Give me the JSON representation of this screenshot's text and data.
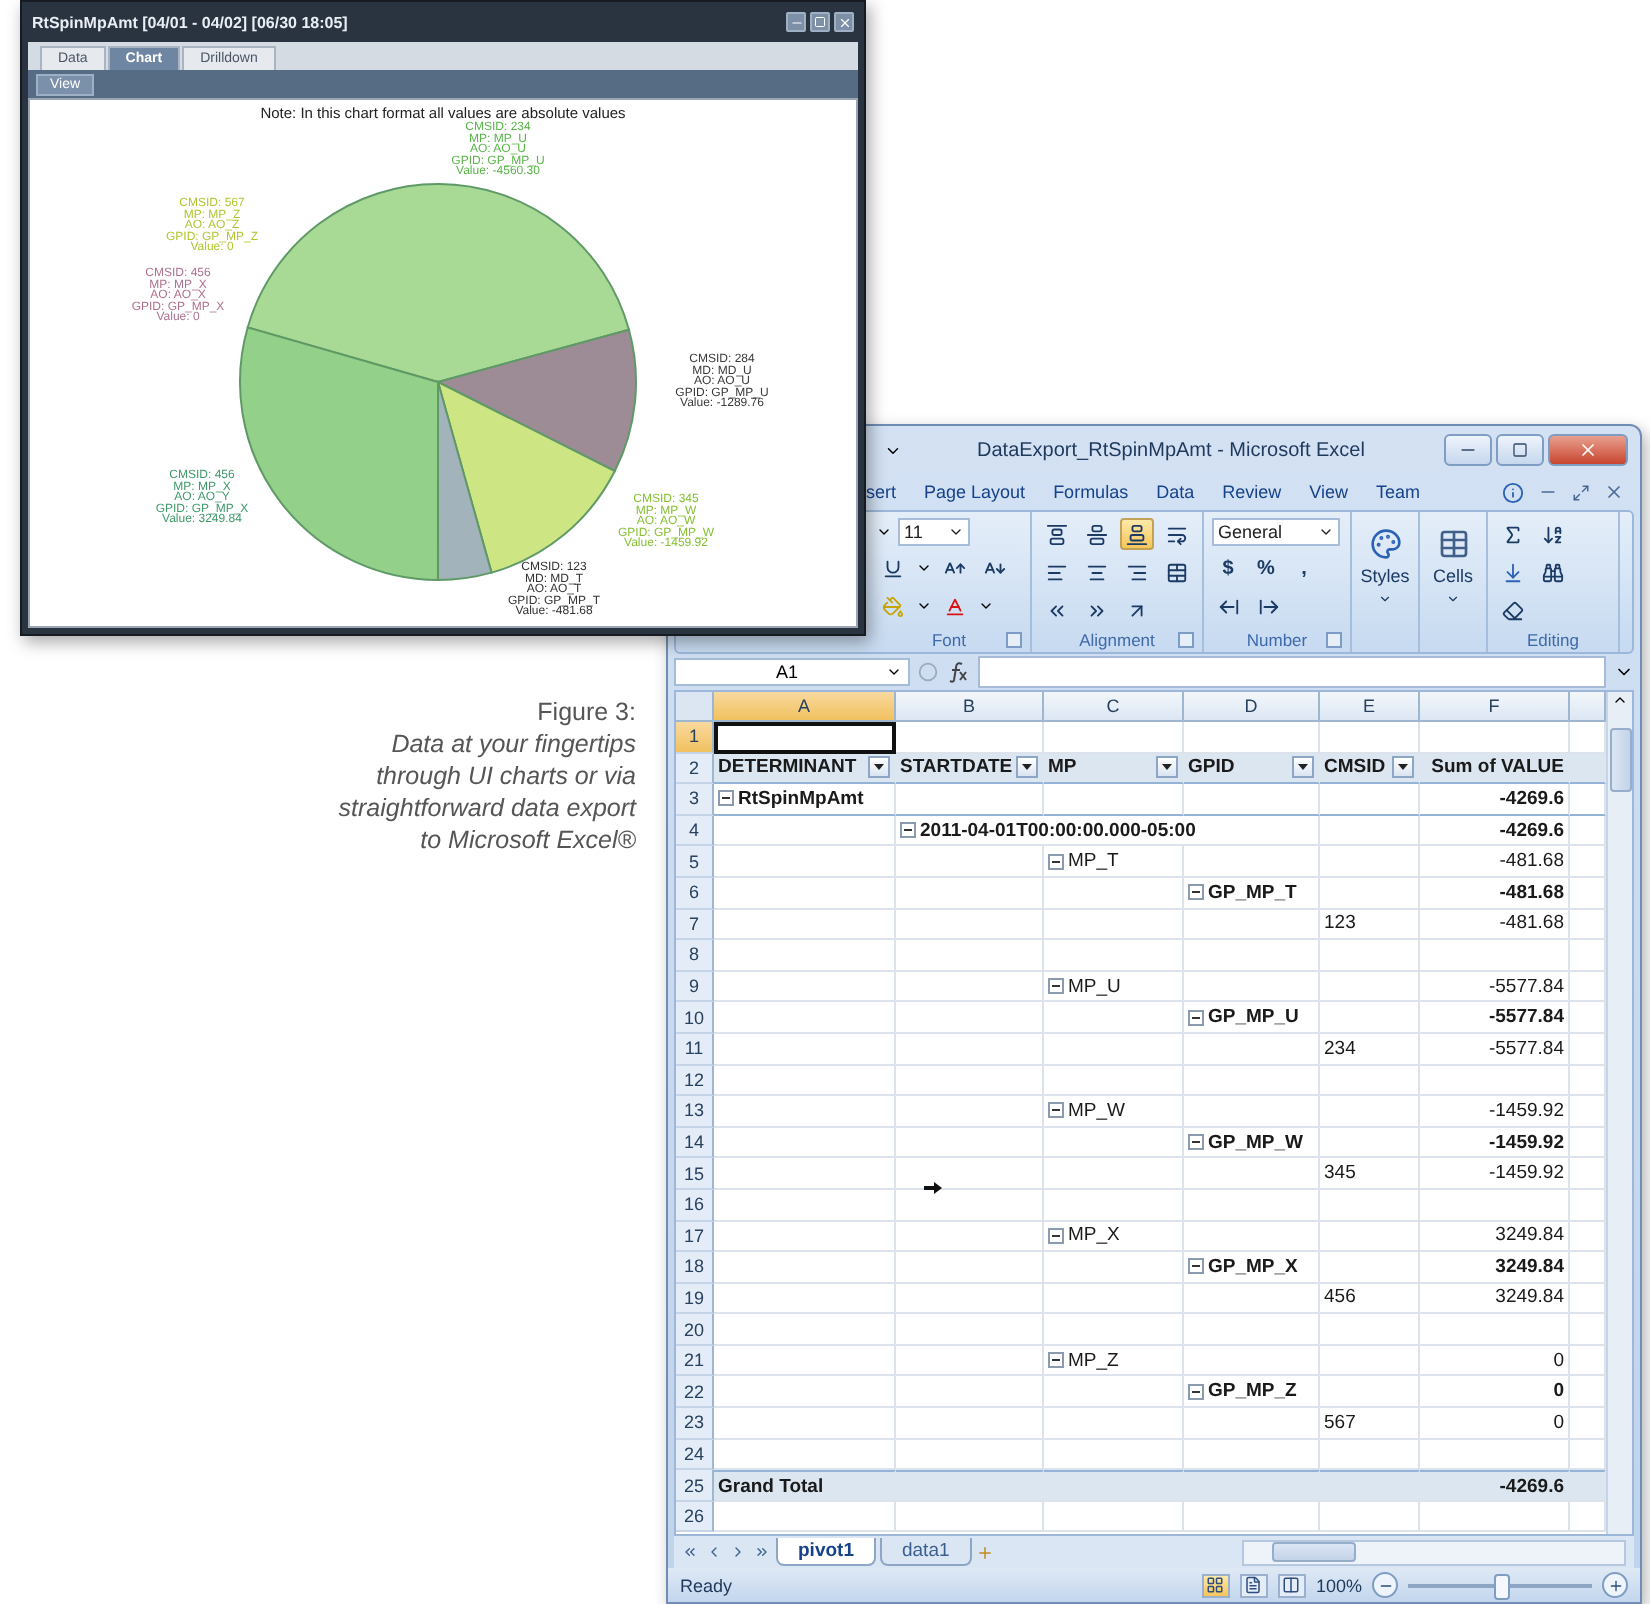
{
  "chart_window": {
    "title": "RtSpinMpAmt [04/01 - 04/02] [06/30 18:05]",
    "tabs": [
      {
        "label": "Data",
        "selected": false
      },
      {
        "label": "Chart",
        "selected": true
      },
      {
        "label": "Drilldown",
        "selected": false
      }
    ],
    "toolbar": {
      "button": "View"
    },
    "chart": {
      "chart_data": {
        "type": "pie",
        "title": "Note: In this chart format all values are absolute values",
        "values": [
          41.3,
          11.68,
          13.22,
          4.36,
          29.44,
          0,
          0
        ]
      },
      "slices": [
        {
          "color": "#a8da96"
        },
        {
          "color": "#9d8c95"
        },
        {
          "color": "#cde583"
        },
        {
          "color": "#a3b3bb"
        },
        {
          "color": "#93d08a"
        }
      ],
      "labels": [
        {
          "color": "#58b548",
          "lines": [
            "CMSID: 234",
            "MP: MP_U",
            "AO: AO_U",
            "GPID: GP_MP_U",
            "Value: -4560.30"
          ]
        },
        {
          "color": "#b3c530",
          "lines": [
            "CMSID: 567",
            "MP: MP_Z",
            "AO: AO_Z",
            "GPID: GP_MP_Z",
            "Value: 0"
          ]
        },
        {
          "color": "#b0708f",
          "lines": [
            "CMSID: 456",
            "MP: MP_X",
            "AO: AO_X",
            "GPID: GP_MP_X",
            "Value: 0"
          ]
        },
        {
          "color": "#3a3a3a",
          "lines": [
            "CMSID: 284",
            "MD: MD_U",
            "AO: AO_U",
            "GPID: GP_MP_U",
            "Value: -1289.76"
          ]
        },
        {
          "color": "#3f9a6a",
          "lines": [
            "CMSID: 456",
            "MP: MP_X",
            "AO: AO_Y",
            "GPID: GP_MP_X",
            "Value: 3249.84"
          ]
        },
        {
          "color": "#86c030",
          "lines": [
            "CMSID: 345",
            "MP: MP_W",
            "AO: AO_W",
            "GPID: GP_MP_W",
            "Value: -1459.92"
          ]
        },
        {
          "color": "#333333",
          "lines": [
            "CMSID: 123",
            "MD: MD_T",
            "AO: AO_T",
            "GPID: GP_MP_T",
            "Value: -481.68"
          ]
        }
      ]
    }
  },
  "excel": {
    "title": "DataExport_RtSpinMpAmt - Microsoft Excel",
    "ribbon_tabs": [
      "sert",
      "Page Layout",
      "Formulas",
      "Data",
      "Review",
      "View",
      "Team"
    ],
    "ribbon": {
      "font": {
        "size": "11",
        "label": "Font"
      },
      "alignment": {
        "label": "Alignment",
        "vertical_align": [
          {
            "kind": "top",
            "selected": false
          },
          {
            "kind": "middle",
            "selected": false
          },
          {
            "kind": "bottom",
            "selected": true
          }
        ]
      },
      "number": {
        "format": "General",
        "symbols": [
          "$",
          "%",
          ","
        ],
        "label": "Number"
      },
      "styles": {
        "label": "Styles"
      },
      "cells": {
        "label": "Cells"
      },
      "editing": {
        "label": "Editing"
      }
    },
    "formula_bar": {
      "name_box": "A1"
    },
    "grid": {
      "columns": [
        {
          "letter": "A",
          "selected": true
        },
        {
          "letter": "B",
          "selected": false
        },
        {
          "letter": "C",
          "selected": false
        },
        {
          "letter": "D",
          "selected": false
        },
        {
          "letter": "E",
          "selected": false
        },
        {
          "letter": "F",
          "selected": false
        }
      ],
      "rows": [
        {
          "number": "1",
          "kind": "blank",
          "selected": true
        },
        {
          "number": "2",
          "kind": "header",
          "selected": false,
          "a": {
            "text": "DETERMINANT",
            "filter": true
          },
          "b": {
            "text": "STARTDATE",
            "filter": true
          },
          "c": {
            "text": "MP",
            "filter": true
          },
          "d": {
            "text": "GPID",
            "filter": true
          },
          "e": {
            "text": "CMSID",
            "filter": true
          },
          "f": {
            "text": "Sum of VALUE"
          }
        },
        {
          "number": "3",
          "kind": "group",
          "selected": false,
          "a": {
            "text": "RtSpinMpAmt",
            "expanded": true
          },
          "f": {
            "text": "-4269.6"
          }
        },
        {
          "number": "4",
          "kind": "bold",
          "selected": false,
          "b": {
            "text": "2011-04-01T00:00:00.000-05:00",
            "expanded": true
          },
          "f": {
            "text": "-4269.6"
          }
        },
        {
          "number": "5",
          "kind": "plain",
          "selected": false,
          "c": {
            "text": "MP_T",
            "expanded": true
          },
          "f": {
            "text": "-481.68"
          }
        },
        {
          "number": "6",
          "kind": "bold",
          "selected": false,
          "d": {
            "text": "GP_MP_T",
            "expanded": true
          },
          "f": {
            "text": "-481.68"
          }
        },
        {
          "number": "7",
          "kind": "plain",
          "selected": false,
          "e": {
            "text": "123"
          },
          "f": {
            "text": "-481.68"
          }
        },
        {
          "number": "8",
          "kind": "blank",
          "selected": false
        },
        {
          "number": "9",
          "kind": "plain",
          "selected": false,
          "c": {
            "text": "MP_U",
            "expanded": true
          },
          "f": {
            "text": "-5577.84"
          }
        },
        {
          "number": "10",
          "kind": "bold",
          "selected": false,
          "d": {
            "text": "GP_MP_U",
            "expanded": true
          },
          "f": {
            "text": "-5577.84"
          }
        },
        {
          "number": "11",
          "kind": "plain",
          "selected": false,
          "e": {
            "text": "234"
          },
          "f": {
            "text": "-5577.84"
          }
        },
        {
          "number": "12",
          "kind": "blank",
          "selected": false
        },
        {
          "number": "13",
          "kind": "plain",
          "selected": false,
          "c": {
            "text": "MP_W",
            "expanded": true
          },
          "f": {
            "text": "-1459.92"
          }
        },
        {
          "number": "14",
          "kind": "bold",
          "selected": false,
          "d": {
            "text": "GP_MP_W",
            "expanded": true
          },
          "f": {
            "text": "-1459.92"
          }
        },
        {
          "number": "15",
          "kind": "plain",
          "selected": false,
          "e": {
            "text": "345"
          },
          "f": {
            "text": "-1459.92"
          }
        },
        {
          "number": "16",
          "kind": "blank",
          "selected": false
        },
        {
          "number": "17",
          "kind": "plain",
          "selected": false,
          "c": {
            "text": "MP_X",
            "expanded": true
          },
          "f": {
            "text": "3249.84"
          }
        },
        {
          "number": "18",
          "kind": "bold",
          "selected": false,
          "d": {
            "text": "GP_MP_X",
            "expanded": true
          },
          "f": {
            "text": "3249.84"
          }
        },
        {
          "number": "19",
          "kind": "plain",
          "selected": false,
          "e": {
            "text": "456"
          },
          "f": {
            "text": "3249.84"
          }
        },
        {
          "number": "20",
          "kind": "blank",
          "selected": false
        },
        {
          "number": "21",
          "kind": "plain",
          "selected": false,
          "c": {
            "text": "MP_Z",
            "expanded": true
          },
          "f": {
            "text": "0"
          }
        },
        {
          "number": "22",
          "kind": "bold",
          "selected": false,
          "d": {
            "text": "GP_MP_Z",
            "expanded": true
          },
          "f": {
            "text": "0"
          }
        },
        {
          "number": "23",
          "kind": "plain",
          "selected": false,
          "e": {
            "text": "567"
          },
          "f": {
            "text": "0"
          }
        },
        {
          "number": "24",
          "kind": "blank",
          "selected": false
        },
        {
          "number": "25",
          "kind": "total",
          "selected": false,
          "a": {
            "text": "Grand Total"
          },
          "f": {
            "text": "-4269.6"
          }
        },
        {
          "number": "26",
          "kind": "blank",
          "selected": false
        }
      ]
    },
    "sheet_tabs": [
      {
        "label": "pivot1",
        "selected": true
      },
      {
        "label": "data1",
        "selected": false
      }
    ],
    "status_bar": {
      "text": "Ready",
      "views": [
        {
          "kind": "normal",
          "selected": true
        },
        {
          "kind": "page_layout",
          "selected": false
        },
        {
          "kind": "page_break",
          "selected": false
        }
      ],
      "zoom": {
        "reading": "100%",
        "level": 0.5
      }
    }
  },
  "caption": {
    "figure": "Figure 3:",
    "text": "Data at your fingertips through UI charts or via straightforward data export to Microsoft Excel®"
  }
}
